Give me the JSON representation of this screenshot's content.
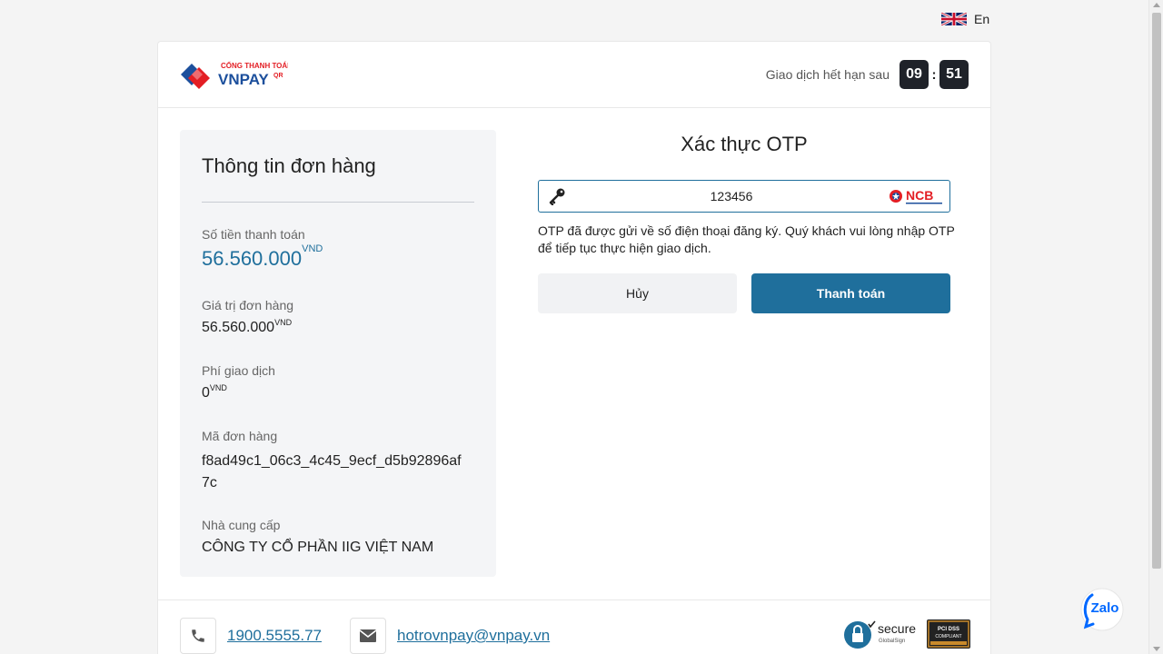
{
  "language": {
    "label": "En"
  },
  "header": {
    "logo_text_top": "CỔNG THANH TOÁN",
    "logo_text_main": "VNPAY",
    "logo_text_qr": "QR",
    "timer_label": "Giao dịch hết hạn sau",
    "timer_minutes": "09",
    "timer_separator": ":",
    "timer_seconds": "51"
  },
  "order": {
    "title": "Thông tin đơn hàng",
    "amount_label": "Số tiền thanh toán",
    "amount_value": "56.560.000",
    "amount_unit": "VND",
    "order_value_label": "Giá trị đơn hàng",
    "order_value": "56.560.000",
    "order_value_unit": "VND",
    "fee_label": "Phí giao dịch",
    "fee_value": "0",
    "fee_unit": "VND",
    "order_id_label": "Mã đơn hàng",
    "order_id_line1": "f8ad49c1_06c3_4c45_9ecf_d5b92896af",
    "order_id_line2": "7c",
    "provider_label": "Nhà cung cấp",
    "provider_value": "CÔNG TY CỔ PHẦN IIG VIỆT NAM"
  },
  "otp": {
    "title": "Xác thực OTP",
    "input_value": "123456",
    "bank_name": "NCB",
    "message": "OTP đã được gửi về số điện thoại đăng ký. Quý khách vui lòng nhập OTP để tiếp tục thực hiện giao dịch.",
    "cancel_label": "Hủy",
    "pay_label": "Thanh toán"
  },
  "footer": {
    "phone": "1900.5555.77",
    "email": "hotrovnpay@vnpay.vn",
    "secure_text": "secure",
    "secure_sub": "GlobalSign",
    "pci_text": "PCI DSS",
    "pci_sub": "COMPLIANT"
  },
  "chat": {
    "label": "Zalo"
  },
  "colors": {
    "primary": "#1f6f9c",
    "timer_bg": "#1f2229",
    "panel_bg": "#f4f5f7",
    "logo_red": "#e31e24",
    "logo_blue": "#1c4f9c"
  }
}
